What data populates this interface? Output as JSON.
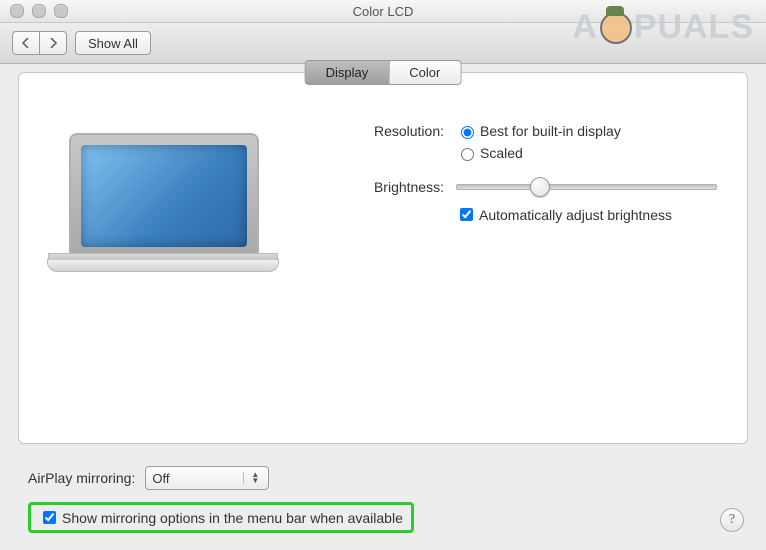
{
  "window": {
    "title": "Color LCD"
  },
  "toolbar": {
    "show_all": "Show All"
  },
  "tabs": {
    "display": "Display",
    "color": "Color"
  },
  "settings": {
    "resolution_label": "Resolution:",
    "resolution_best": "Best for built-in display",
    "resolution_scaled": "Scaled",
    "brightness_label": "Brightness:",
    "auto_brightness": "Automatically adjust brightness"
  },
  "airplay": {
    "label": "AirPlay mirroring:",
    "value": "Off"
  },
  "mirroring_checkbox": "Show mirroring options in the menu bar when available",
  "help_glyph": "?",
  "watermark": {
    "left": "A",
    "right": "PUALS"
  }
}
